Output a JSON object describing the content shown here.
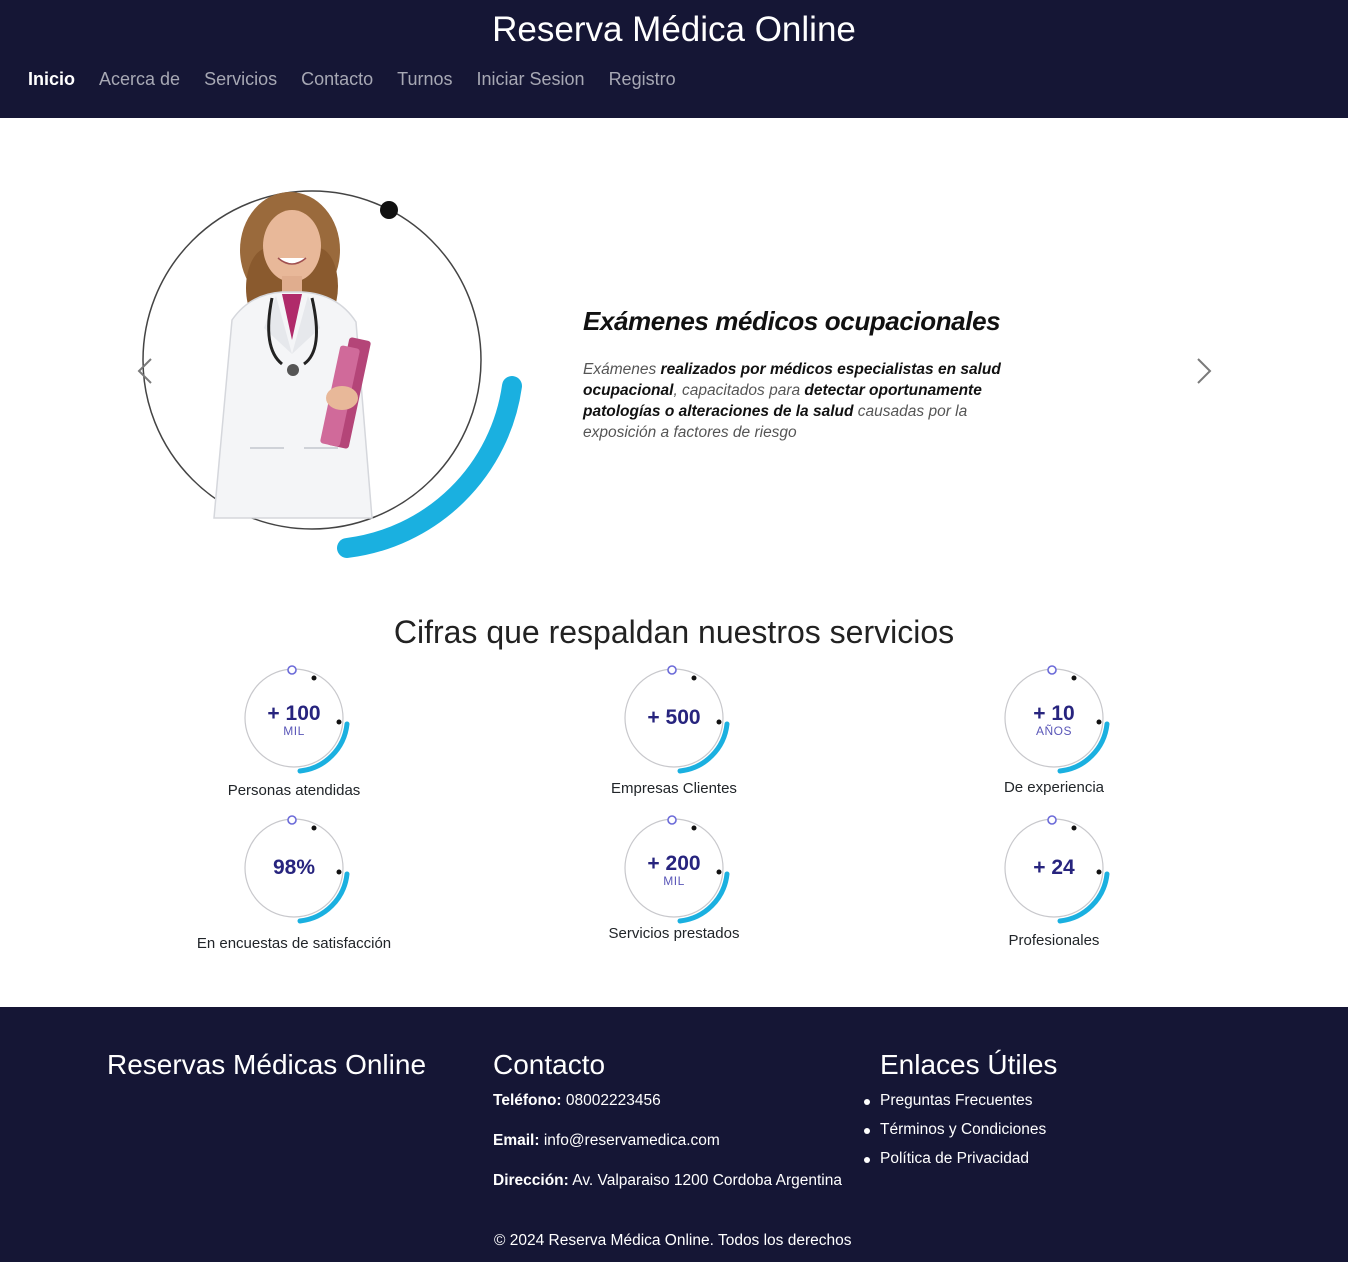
{
  "header": {
    "title": "Reserva Médica Online",
    "nav": [
      "Inicio",
      "Acerca de",
      "Servicios",
      "Contacto",
      "Turnos",
      "Iniciar Sesion",
      "Registro"
    ]
  },
  "carousel": {
    "heading": "Exámenes médicos ocupacionales",
    "text": {
      "p1": "Exámenes ",
      "b1": "realizados por médicos especialistas en salud ocupacional",
      "p2": ", capacitados para ",
      "b2": "detectar oportunamente patologías o alteraciones de la salud",
      "p3": " causadas por la exposición a factores de riesgo"
    },
    "prev_icon": "chevron-left-icon",
    "next_icon": "chevron-right-icon",
    "accent": "#1ab0e0"
  },
  "stats": {
    "title": "Cifras que respaldan nuestros servicios",
    "items": [
      {
        "value": "+ 100",
        "unit": "MIL",
        "label": "Personas atendidas"
      },
      {
        "value": "+ 500",
        "unit": "",
        "label": "Empresas Clientes"
      },
      {
        "value": "+ 10",
        "unit": "AÑOS",
        "label": "De experiencia"
      },
      {
        "value": "98%",
        "unit": "",
        "label": "En encuestas de satisfacción"
      },
      {
        "value": "+ 200",
        "unit": "MIL",
        "label": "Servicios prestados"
      },
      {
        "value": "+ 24",
        "unit": "",
        "label": "Profesionales"
      }
    ]
  },
  "footer": {
    "brand": "Reservas Médicas Online",
    "contact": {
      "title": "Contacto",
      "phone_label": "Teléfono:",
      "phone": "08002223456",
      "email_label": "Email:",
      "email": "info@reservamedica.com",
      "address_label": "Dirección:",
      "address": "Av. Valparaiso 1200 Cordoba Argentina",
      "copyright": "© 2024 Reserva Médica Online. Todos los derechos"
    },
    "links": {
      "title": "Enlaces Útiles",
      "items": [
        "Preguntas Frecuentes",
        "Términos y Condiciones",
        "Política de Privacidad"
      ]
    }
  },
  "colors": {
    "navy": "#151635",
    "accent_blue": "#1ab0e0",
    "stat_value": "#27247e"
  }
}
